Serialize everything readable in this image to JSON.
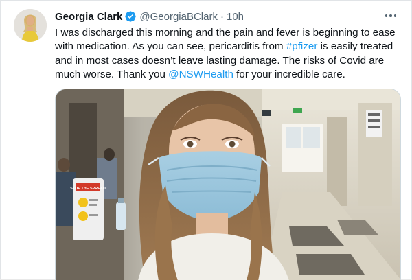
{
  "tweet": {
    "author": {
      "name": "Georgia Clark",
      "handle": "@GeorgiaBClark",
      "avatar_icon": "profile-photo",
      "verified_icon": "verified-badge-icon"
    },
    "separator": "·",
    "time": "10h",
    "more_icon": "more-options-icon",
    "text": {
      "part1": "I was discharged this morning and the pain and fever is beginning to ease with medication. As you can see, pericarditis from ",
      "hashtag": "#pfizer",
      "part2": " is easily treated and in most cases doesn’t leave lasting damage. The risks of Covid are much worse. Thank you ",
      "mention": "@NSWHealth",
      "part3": " for your incredible care."
    },
    "media": {
      "description_icon": "selfie-photo",
      "sign_text": "STOP THE SPREAD"
    }
  },
  "colors": {
    "link": "#1d9bf0",
    "verified": "#1d9bf0",
    "text": "#0f1419",
    "secondary": "#536471"
  }
}
